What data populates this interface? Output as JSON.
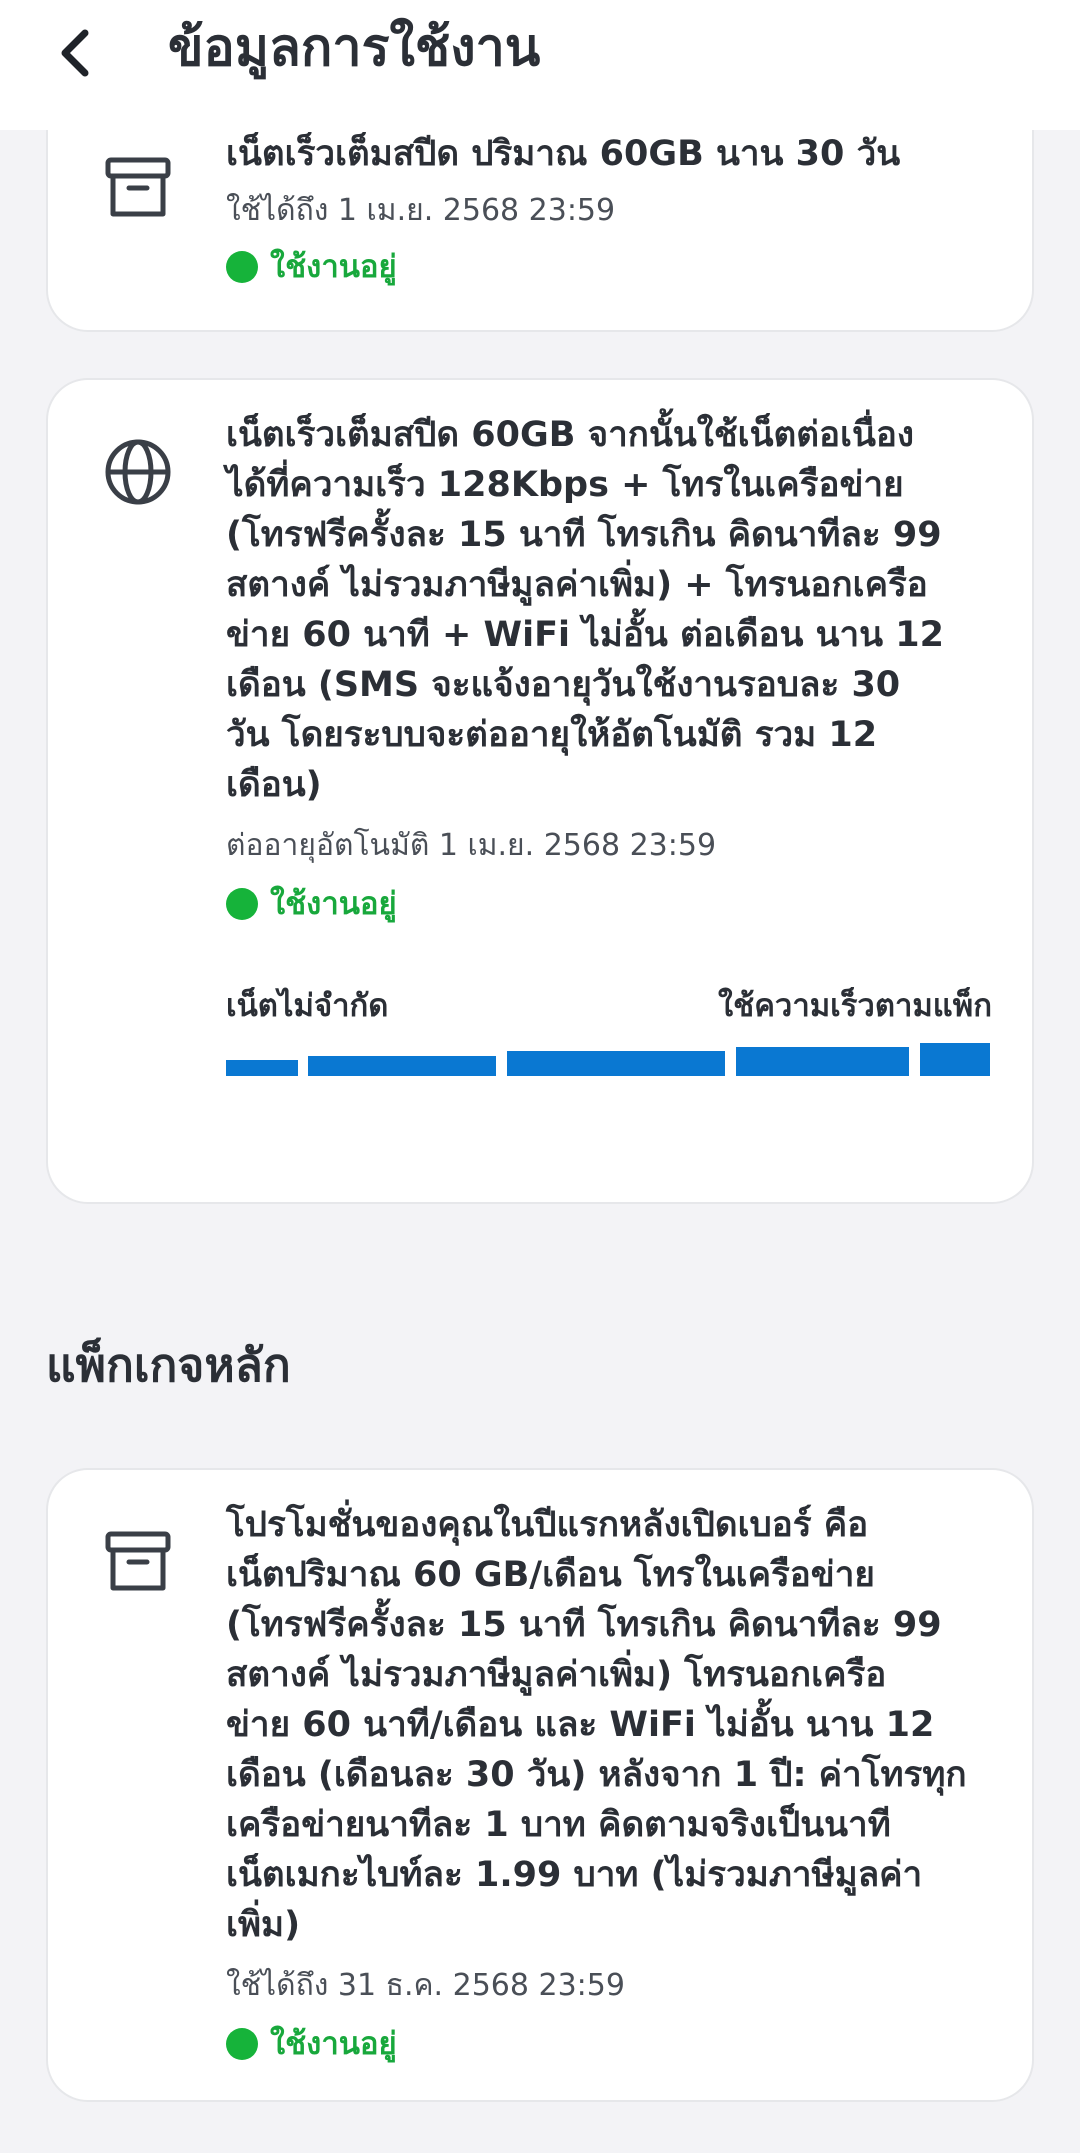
{
  "header": {
    "title": "ข้อมูลการใช้งาน"
  },
  "cards": [
    {
      "icon": "archive-box-icon",
      "title": "เน็ตเร็วเต็มสปีด ปริมาณ 60GB นาน 30 วัน",
      "date": "ใช้ได้ถึง 1 เม.ย. 2568 23:59",
      "status": "ใช้งานอยู่"
    },
    {
      "icon": "globe-icon",
      "title_lines": [
        "เน็ตเร็วเต็มสปีด 60GB จากนั้นใช้เน็ตต่อเนื่อง",
        "ได้ที่ความเร็ว 128Kbps + โทรในเครือข่าย",
        "(โทรฟรีครั้งละ 15 นาที โทรเกิน คิดนาทีละ 99",
        "สตางค์ ไม่รวมภาษีมูลค่าเพิ่ม) + โทรนอกเครือ",
        "ข่าย 60 นาที + WiFi ไม่อั้น ต่อเดือน นาน 12",
        "เดือน (SMS จะแจ้งอายุวันใช้งานรอบละ 30",
        "วัน โดยระบบจะต่ออายุให้อัตโนมัติ รวม 12",
        "เดือน)"
      ],
      "date": "ต่ออายุอัตโนมัติ 1 เม.ย. 2568 23:59",
      "status": "ใช้งานอยู่",
      "usage": {
        "left_label": "เน็ตไม่จำกัด",
        "right_label": "ใช้ความเร็วตามแพ็ก",
        "color": "#0a78d2"
      }
    }
  ],
  "main_package": {
    "section_title": "แพ็กเกจหลัก",
    "icon": "archive-box-icon",
    "title_lines": [
      "โปรโมชั่นของคุณในปีแรกหลังเปิดเบอร์ คือ",
      "เน็ตปริมาณ 60 GB/เดือน โทรในเครือข่าย",
      "(โทรฟรีครั้งละ 15 นาที โทรเกิน คิดนาทีละ 99",
      "สตางค์ ไม่รวมภาษีมูลค่าเพิ่ม) โทรนอกเครือ",
      "ข่าย 60 นาที/เดือน และ WiFi ไม่อั้น นาน 12",
      "เดือน (เดือนละ 30 วัน) หลังจาก 1 ปี: ค่าโทรทุก",
      "เครือข่ายนาทีละ 1 บาท คิดตามจริงเป็นนาที",
      "เน็ตเมกะไบท์ละ 1.99 บาท (ไม่รวมภาษีมูลค่า",
      "เพิ่ม)"
    ],
    "date": "ใช้ได้ถึง 31 ธ.ค. 2568 23:59",
    "status": "ใช้งานอยู่"
  },
  "colors": {
    "status_green": "#18a83c",
    "accent_blue": "#0a78d2",
    "background": "#f3f3f6"
  }
}
